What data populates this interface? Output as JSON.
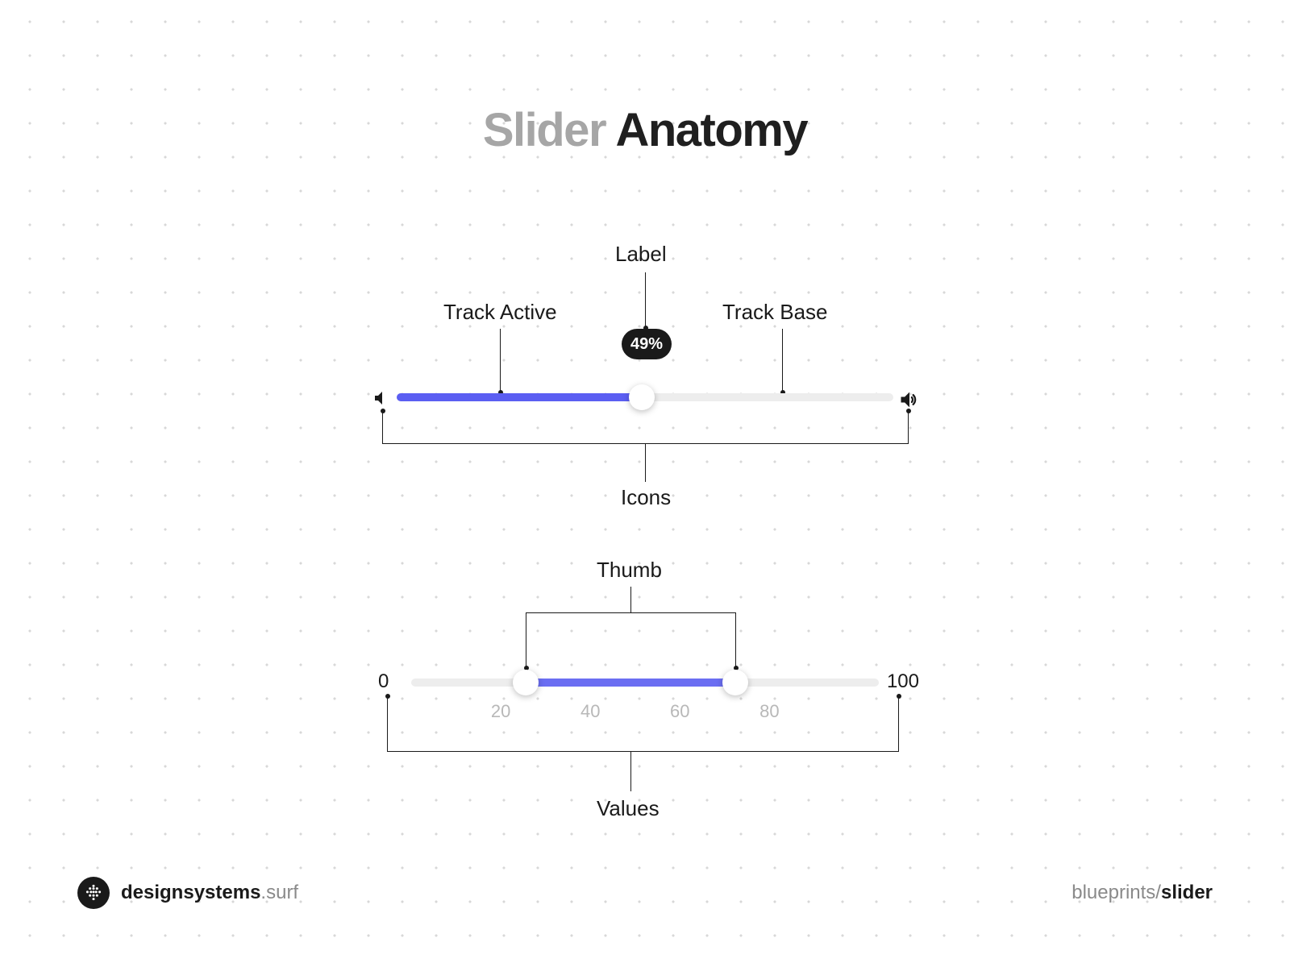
{
  "title": {
    "light": "Slider",
    "dark": "Anatomy"
  },
  "annotations": {
    "label": "Label",
    "track_active": "Track Active",
    "track_base": "Track Base",
    "icons": "Icons",
    "thumb": "Thumb",
    "values": "Values"
  },
  "slider1": {
    "percent_label": "49%"
  },
  "slider2": {
    "min": "0",
    "max": "100",
    "ticks": [
      "0",
      "20",
      "40",
      "60",
      "80",
      "100"
    ]
  },
  "footer": {
    "brand_dark": "designsystems",
    "brand_grey": ".surf",
    "path_grey": "blueprints/",
    "path_dark": "slider"
  }
}
